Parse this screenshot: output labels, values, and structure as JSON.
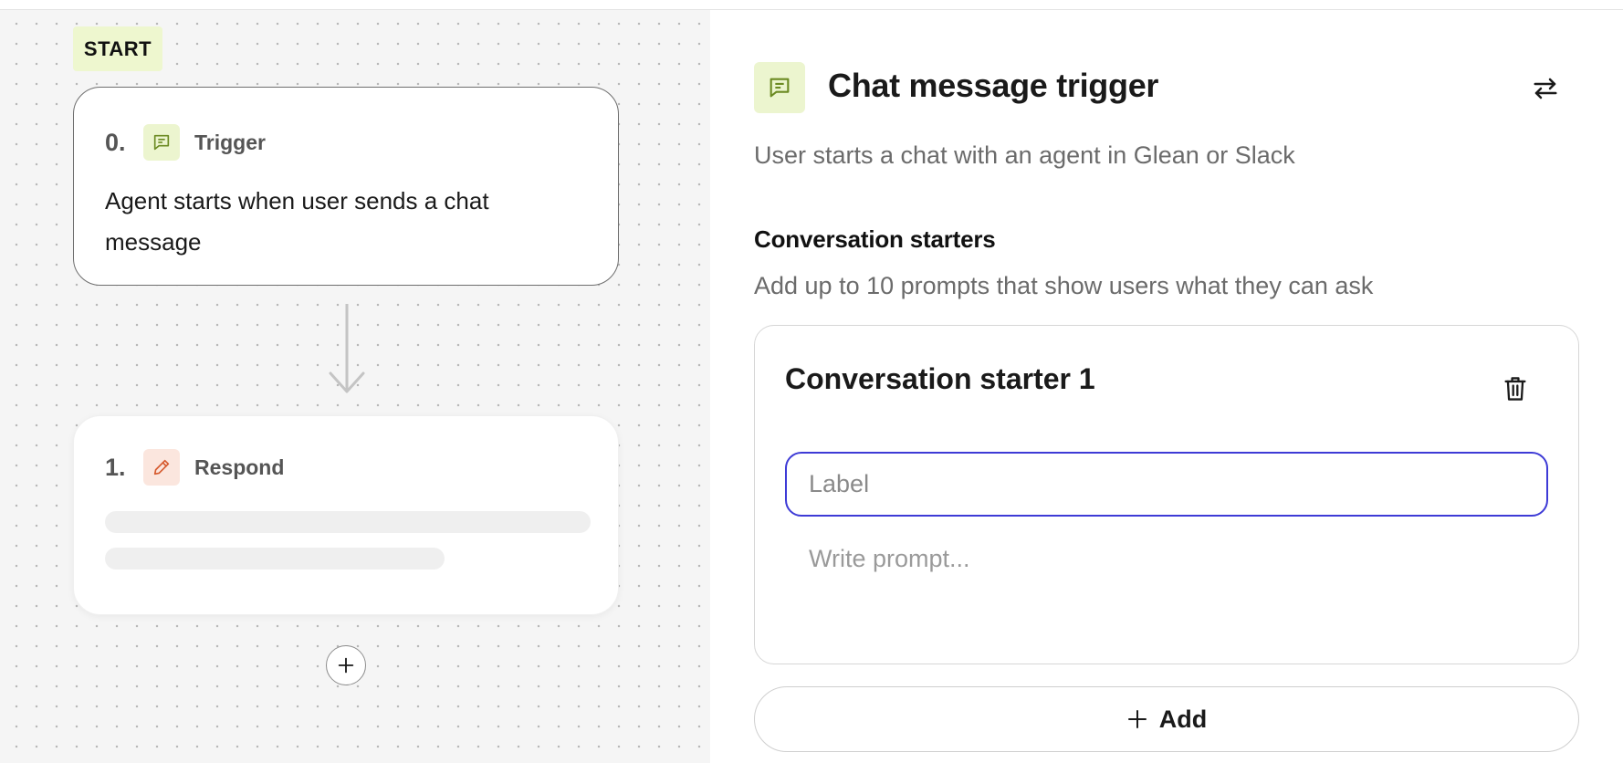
{
  "canvas": {
    "start_label": "START",
    "nodes": [
      {
        "index": "0.",
        "type": "Trigger",
        "icon": "chat-message-icon",
        "description": "Agent starts when user sends a chat message"
      },
      {
        "index": "1.",
        "type": "Respond",
        "icon": "pencil-icon"
      }
    ],
    "add_node_icon": "plus-icon"
  },
  "panel": {
    "icon": "chat-message-icon",
    "title": "Chat message trigger",
    "swap_icon": "swap-arrows-icon",
    "subtitle": "User starts a chat with an agent in Glean or Slack",
    "section": {
      "title": "Conversation starters",
      "description": "Add up to 10 prompts that show users what they can ask",
      "starters": [
        {
          "title": "Conversation starter 1",
          "label_placeholder": "Label",
          "label_value": "",
          "prompt_placeholder": "Write prompt...",
          "prompt_value": "",
          "delete_icon": "trash-icon"
        }
      ],
      "add_label": "Add",
      "add_icon": "plus-icon"
    }
  },
  "colors": {
    "accent_focus": "#3e3bd6",
    "trigger_icon_bg": "#ecf5cf",
    "trigger_icon_fg": "#6b8a22",
    "respond_icon_bg": "#fbe6de",
    "respond_icon_fg": "#d65a2e",
    "start_badge_bg": "#eef7cf"
  }
}
